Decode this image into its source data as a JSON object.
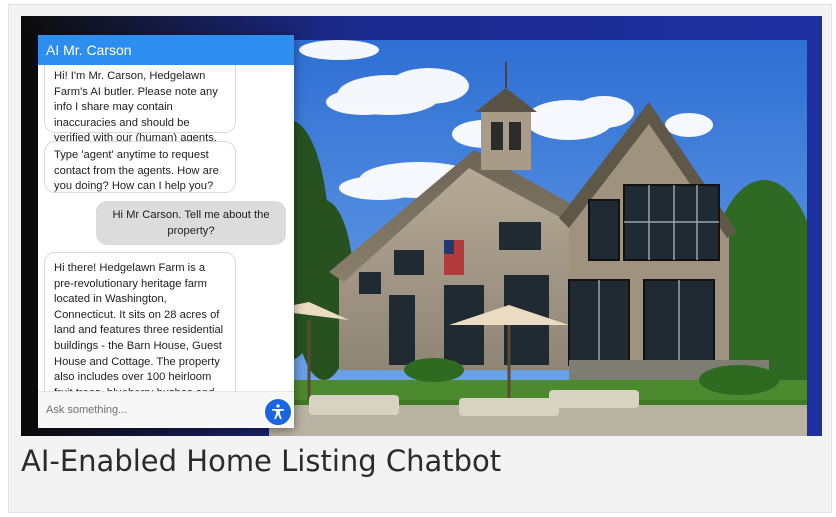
{
  "chat": {
    "title": "AI Mr. Carson",
    "messages": [
      {
        "from": "bot",
        "text": "Hi! I'm Mr. Carson, Hedgelawn Farm's AI butler. Please note any info I share may contain inaccuracies and should be verified with our (human) agents."
      },
      {
        "from": "bot",
        "text": "Type 'agent' anytime to request contact from the agents. How are you doing? How can I help you?"
      },
      {
        "from": "user",
        "text": "Hi Mr Carson. Tell me about the property?"
      },
      {
        "from": "bot",
        "text": "Hi there! Hedgelawn Farm is a pre-revolutionary heritage farm located in Washington, Connecticut. It sits on 28 acres of land and features three residential buildings - the Barn House, Guest House and Cottage. The property also includes over 100 heirloom fruit trees, blueberry bushes and berry vines as well as hiking or jogging trails through the woods. All"
      }
    ],
    "input_placeholder": "Ask something...",
    "accessibility_icon": "accessibility-icon"
  },
  "caption": "AI-Enabled Home Listing Chatbot",
  "colors": {
    "header": "#2e8ef0",
    "accessibility_button": "#1a66e0",
    "background_gradient_end": "#1e2fa0"
  }
}
